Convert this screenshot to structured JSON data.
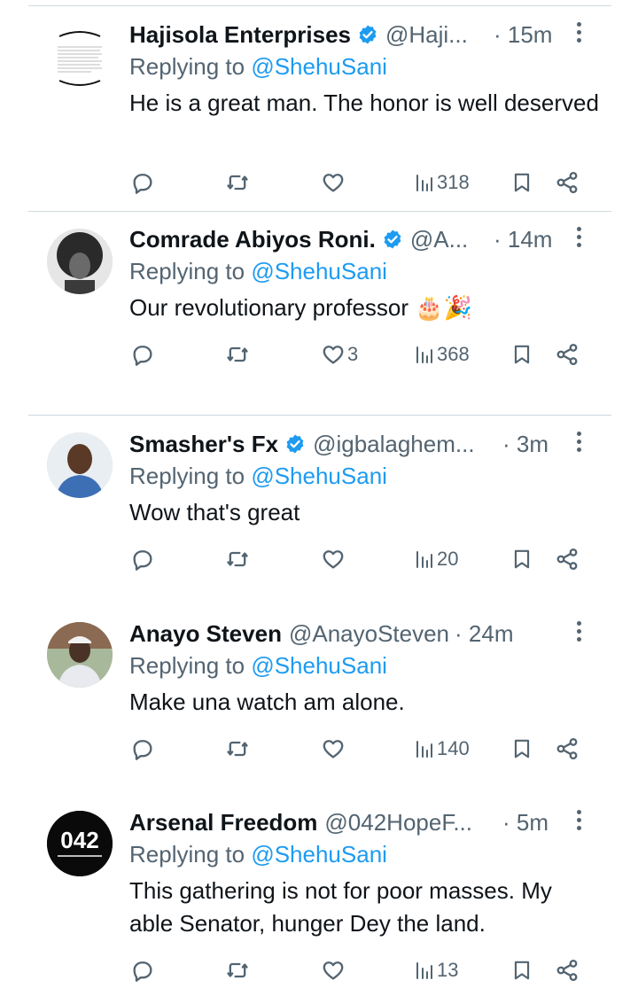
{
  "colors": {
    "text": "#0f1419",
    "muted": "#536471",
    "link": "#1d9bf0",
    "divider": "#cfd9de",
    "verified": "#1d9bf0"
  },
  "icons": {
    "reply": "reply-icon",
    "retweet": "retweet-icon",
    "like": "heart-icon",
    "views": "views-icon",
    "bookmark": "bookmark-icon",
    "share": "share-icon",
    "more": "more-icon",
    "verified": "verified-badge-icon"
  },
  "tweets": [
    {
      "name": "Hajisola Enterprises",
      "verified": true,
      "handle": "@Haji...",
      "time": "· 15m",
      "replying_prefix": "Replying to",
      "replying_to": "@ShehuSani",
      "text": "He is a great man. The honor is well deserved",
      "likes": "",
      "views": "318"
    },
    {
      "name": "Comrade Abiyos Roni.",
      "verified": true,
      "handle": "@A...",
      "time": "· 14m",
      "replying_prefix": "Replying to",
      "replying_to": "@ShehuSani",
      "text": "Our revolutionary professor 🎂🎉",
      "likes": "3",
      "views": "368"
    },
    {
      "name": "Smasher's Fx",
      "verified": true,
      "handle": "@igbalaghem...",
      "time": "· 3m",
      "replying_prefix": "Replying to",
      "replying_to": "@ShehuSani",
      "text": "Wow that's great",
      "likes": "",
      "views": "20"
    },
    {
      "name": "Anayo Steven",
      "verified": false,
      "handle": "@AnayoSteven",
      "time": "· 24m",
      "replying_prefix": "Replying to",
      "replying_to": "@ShehuSani",
      "text": "Make una watch am alone.",
      "likes": "",
      "views": "140"
    },
    {
      "name": "Arsenal Freedom",
      "verified": false,
      "handle": "@042HopeF...",
      "time": "· 5m",
      "replying_prefix": "Replying to",
      "replying_to": "@ShehuSani",
      "text": "This gathering is not for poor masses. My able Senator, hunger Dey the land.",
      "likes": "",
      "views": "13",
      "avatar_text": "042"
    }
  ]
}
